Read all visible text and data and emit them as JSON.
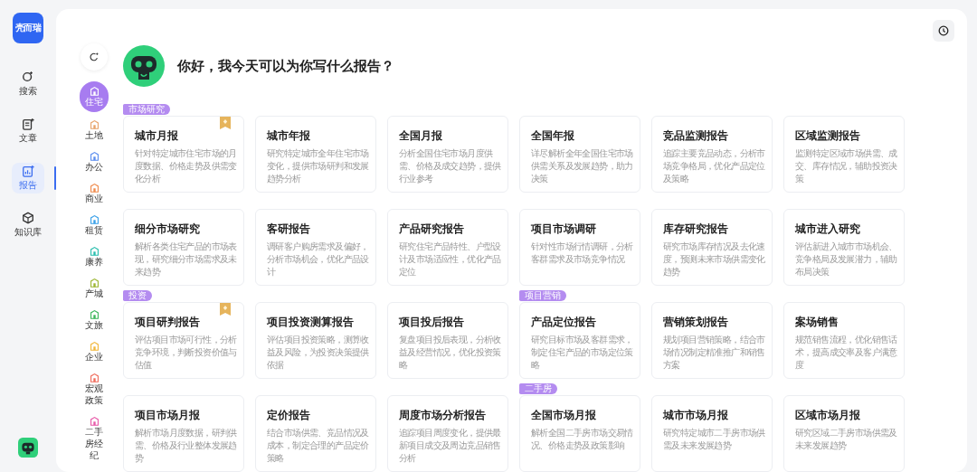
{
  "logo": {
    "text": "壳而瑞"
  },
  "nav": [
    {
      "label": "搜索",
      "selected": false
    },
    {
      "label": "文章",
      "selected": false
    },
    {
      "label": "报告",
      "selected": true
    },
    {
      "label": "知识库",
      "selected": false
    }
  ],
  "categories": [
    {
      "label": "住宅",
      "color": "#a77cf0",
      "selected": true
    },
    {
      "label": "土地",
      "color": "#e8a36a",
      "selected": false
    },
    {
      "label": "办公",
      "color": "#5b8def",
      "selected": false
    },
    {
      "label": "商业",
      "color": "#f08a4b",
      "selected": false
    },
    {
      "label": "租赁",
      "color": "#3aa0e8",
      "selected": false
    },
    {
      "label": "康养",
      "color": "#2bbfae",
      "selected": false
    },
    {
      "label": "产城",
      "color": "#9cb531",
      "selected": false
    },
    {
      "label": "文旅",
      "color": "#3cb65a",
      "selected": false
    },
    {
      "label": "企业",
      "color": "#f2b73a",
      "selected": false
    },
    {
      "label": "宏观政策",
      "color": "#f06b5b",
      "selected": false
    },
    {
      "label": "二手房经纪",
      "color": "#e85aa9",
      "selected": false
    }
  ],
  "greeting": "你好，我今天可以为你写什么报告？",
  "cards": [
    {
      "tag": "市场研究",
      "premium": true,
      "title": "城市月报",
      "desc": "针对特定城市住宅市场的月度数据、价格走势及供需变化分析"
    },
    {
      "premium": false,
      "title": "城市年报",
      "desc": "研究特定城市全年住宅市场变化，提供市场研判和发展趋势分析"
    },
    {
      "premium": false,
      "title": "全国月报",
      "desc": "分析全国住宅市场月度供需、价格及成交趋势，提供行业参考"
    },
    {
      "premium": false,
      "title": "全国年报",
      "desc": "详尽解析全年全国住宅市场供需关系及发展趋势，助力决策"
    },
    {
      "premium": false,
      "title": "竞品监测报告",
      "desc": "追踪主要竞品动态，分析市场竞争格局，优化产品定位及策略"
    },
    {
      "premium": false,
      "title": "区域监测报告",
      "desc": "监测特定区域市场供需、成交、库存情况，辅助投资决策"
    },
    {
      "premium": false,
      "title": "细分市场研究",
      "desc": "解析各类住宅产品的市场表现，研究细分市场需求及未来趋势"
    },
    {
      "premium": false,
      "title": "客研报告",
      "desc": "调研客户购房需求及偏好，分析市场机会，优化产品设计"
    },
    {
      "premium": false,
      "title": "产品研究报告",
      "desc": "研究住宅产品特性、户型设计及市场适应性，优化产品定位"
    },
    {
      "premium": false,
      "title": "项目市场调研",
      "desc": "针对性市场行情调研，分析客群需求及市场竞争情况"
    },
    {
      "premium": false,
      "title": "库存研究报告",
      "desc": "研究市场库存情况及去化速度，预测未来市场供需变化趋势"
    },
    {
      "premium": false,
      "title": "城市进入研究",
      "desc": "评估新进入城市市场机会、竞争格局及发展潜力，辅助布局决策"
    },
    {
      "tag": "投资",
      "premium": true,
      "title": "项目研判报告",
      "desc": "评估项目市场可行性，分析竞争环境，判断投资价值与估值"
    },
    {
      "premium": false,
      "title": "项目投资测算报告",
      "desc": "评估项目投资策略，测算收益及风险，为投资决策提供依据"
    },
    {
      "premium": false,
      "title": "项目投后报告",
      "desc": "复盘项目投后表现，分析收益及经营情况，优化投资策略"
    },
    {
      "tag": "项目营销",
      "premium": false,
      "title": "产品定位报告",
      "desc": "研究目标市场及客群需求，制定住宅产品的市场定位策略"
    },
    {
      "premium": false,
      "title": "营销策划报告",
      "desc": "规划项目营销策略，结合市场情况制定精准推广和销售方案"
    },
    {
      "premium": false,
      "title": "案场销售",
      "desc": "规范销售流程，优化销售话术，提高成交率及客户满意度"
    },
    {
      "premium": false,
      "title": "项目市场月报",
      "desc": "解析市场月度数据，研判供需、价格及行业整体发展趋势"
    },
    {
      "premium": false,
      "title": "定价报告",
      "desc": "结合市场供需、竞品情况及成本，制定合理的产品定价策略"
    },
    {
      "premium": false,
      "title": "周度市场分析报告",
      "desc": "追踪项目周度变化，提供最新项目成交及周边竞品销售分析"
    },
    {
      "tag": "二手房",
      "premium": false,
      "title": "全国市场月报",
      "desc": "解析全国二手房市场交易情况、价格走势及政策影响"
    },
    {
      "premium": false,
      "title": "城市市场月报",
      "desc": "研究特定城市二手房市场供需及未来发展趋势"
    },
    {
      "premium": false,
      "title": "区域市场月报",
      "desc": "研究区域二手房市场供需及未来发展趋势"
    }
  ]
}
